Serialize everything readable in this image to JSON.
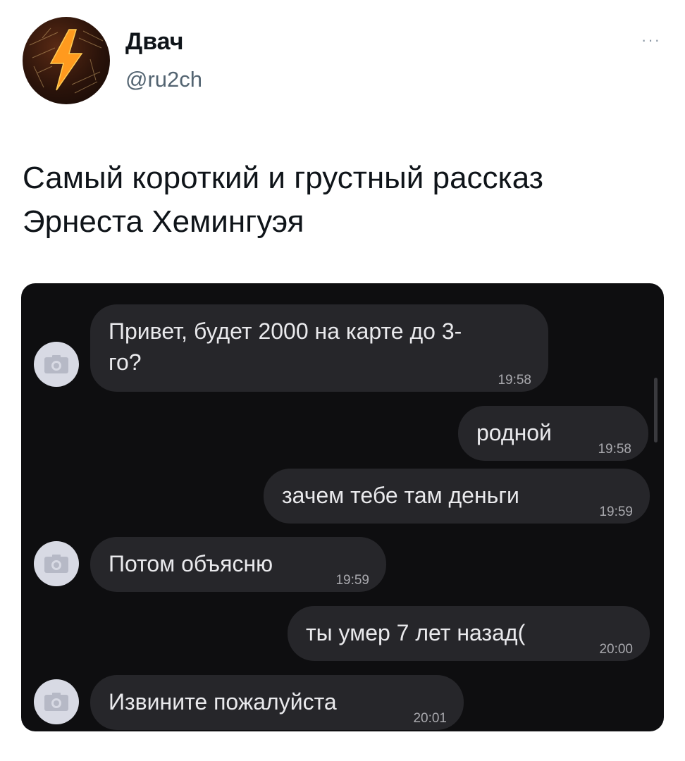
{
  "header": {
    "display_name": "Двач",
    "handle": "@ru2ch",
    "more_label": "···"
  },
  "tweet": {
    "line1": "Самый короткий и грустный рассказ",
    "line2": "Эрнеста Хемингуэя"
  },
  "messages": [
    {
      "side": "in",
      "line1": "Привет, будет 2000 на карте до 3-",
      "line2": "го?",
      "time": "19:58"
    },
    {
      "side": "out",
      "text": "родной",
      "time": "19:58"
    },
    {
      "side": "out",
      "text": "зачем тебе там деньги",
      "time": "19:59"
    },
    {
      "side": "in",
      "text": "Потом объясню",
      "time": "19:59"
    },
    {
      "side": "out",
      "text": "ты умер 7 лет назад(",
      "time": "20:00"
    },
    {
      "side": "in",
      "text": "Извините пожалуйста",
      "time": "20:01"
    }
  ],
  "colors": {
    "chat_background": "#0e0e10",
    "bubble": "#26262a",
    "avatar_placeholder": "#d8dae4"
  },
  "icons": [
    "avatar-logo",
    "more-icon",
    "camera-icon"
  ]
}
